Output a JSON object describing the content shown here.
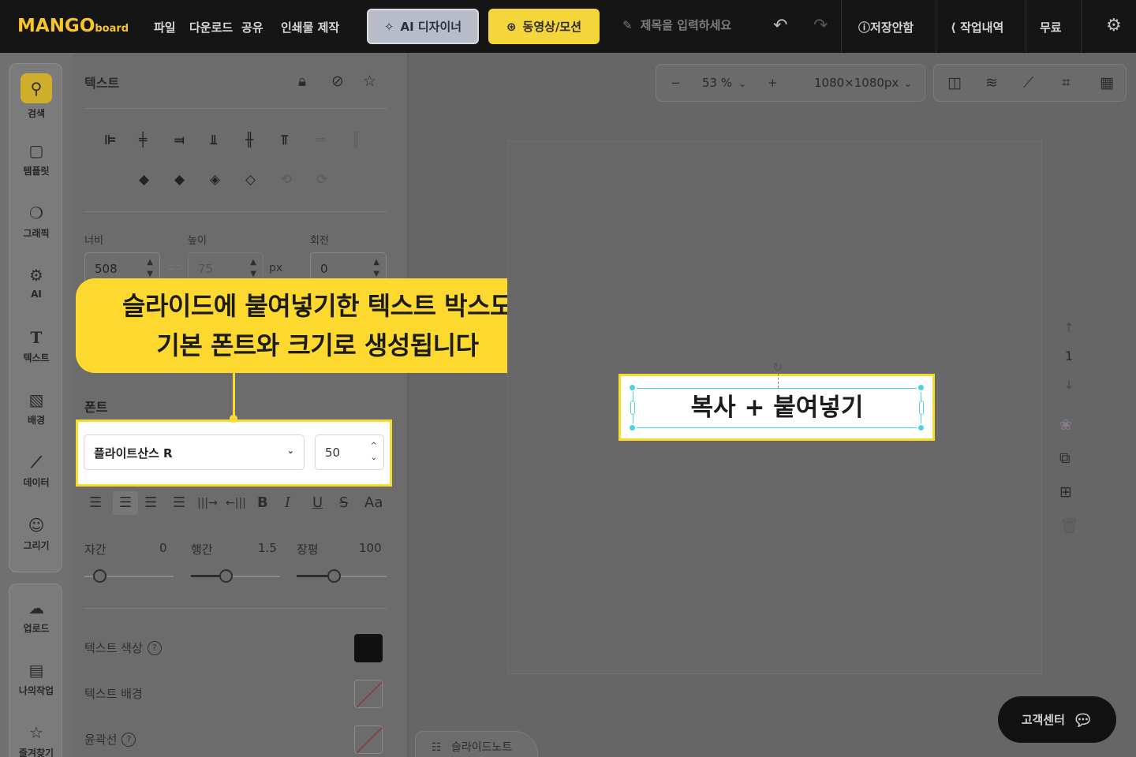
{
  "topbar": {
    "logo_main": "MANGO",
    "logo_sub": "board",
    "menu": [
      "파일",
      "다운로드",
      "공유",
      "인쇄물 제작"
    ],
    "ai_designer": "AI 디자이너",
    "video_motion": "동영상/모션",
    "title_placeholder": "제목을 입력하세요",
    "save_status": "저장안함",
    "history": "작업내역",
    "plan": "무료"
  },
  "sidebar": {
    "items": [
      {
        "label": "검색",
        "icon": "search-icon"
      },
      {
        "label": "템플릿",
        "icon": "template-icon"
      },
      {
        "label": "그래픽",
        "icon": "graphic-icon"
      },
      {
        "label": "AI",
        "icon": "ai-chip-icon"
      },
      {
        "label": "텍스트",
        "icon": "text-icon"
      },
      {
        "label": "배경",
        "icon": "background-icon"
      },
      {
        "label": "데이터",
        "icon": "chart-icon"
      },
      {
        "label": "그리기",
        "icon": "draw-icon"
      }
    ],
    "bottom_items": [
      {
        "label": "업로드",
        "icon": "upload-icon"
      },
      {
        "label": "나의작업",
        "icon": "my-work-icon"
      },
      {
        "label": "즐겨찾기",
        "icon": "favorite-icon"
      }
    ]
  },
  "panel": {
    "title": "텍스트",
    "width_label": "너비",
    "height_label": "높이",
    "rotation_label": "회전",
    "width_value": "508",
    "height_value": "75",
    "unit": "px",
    "rotation_value": "0",
    "font_section": "폰트",
    "font_name": "플라이트산스 R",
    "font_size": "50",
    "letter_spacing_label": "자간",
    "letter_spacing_value": "0",
    "line_height_label": "행간",
    "line_height_value": "1.5",
    "width_ratio_label": "장평",
    "width_ratio_value": "100",
    "text_color_label": "텍스트 색상",
    "text_bg_label": "텍스트 배경",
    "outline_label": "윤곽선",
    "text_color": "#111111"
  },
  "callout": {
    "line1": "슬라이드에 붙여넣기한 텍스트 박스도",
    "line2": "기본 폰트와 크기로 생성됩니다"
  },
  "canvas": {
    "zoom": "53 %",
    "size": "1080×1080px",
    "text_box": "복사 + 붙여넣기",
    "page_number": "1"
  },
  "footer": {
    "customer_center": "고객센터",
    "slide_note": "슬라이드노트"
  },
  "colors": {
    "accent_yellow": "#fdd930",
    "selection_cyan": "#4bd4e0"
  }
}
